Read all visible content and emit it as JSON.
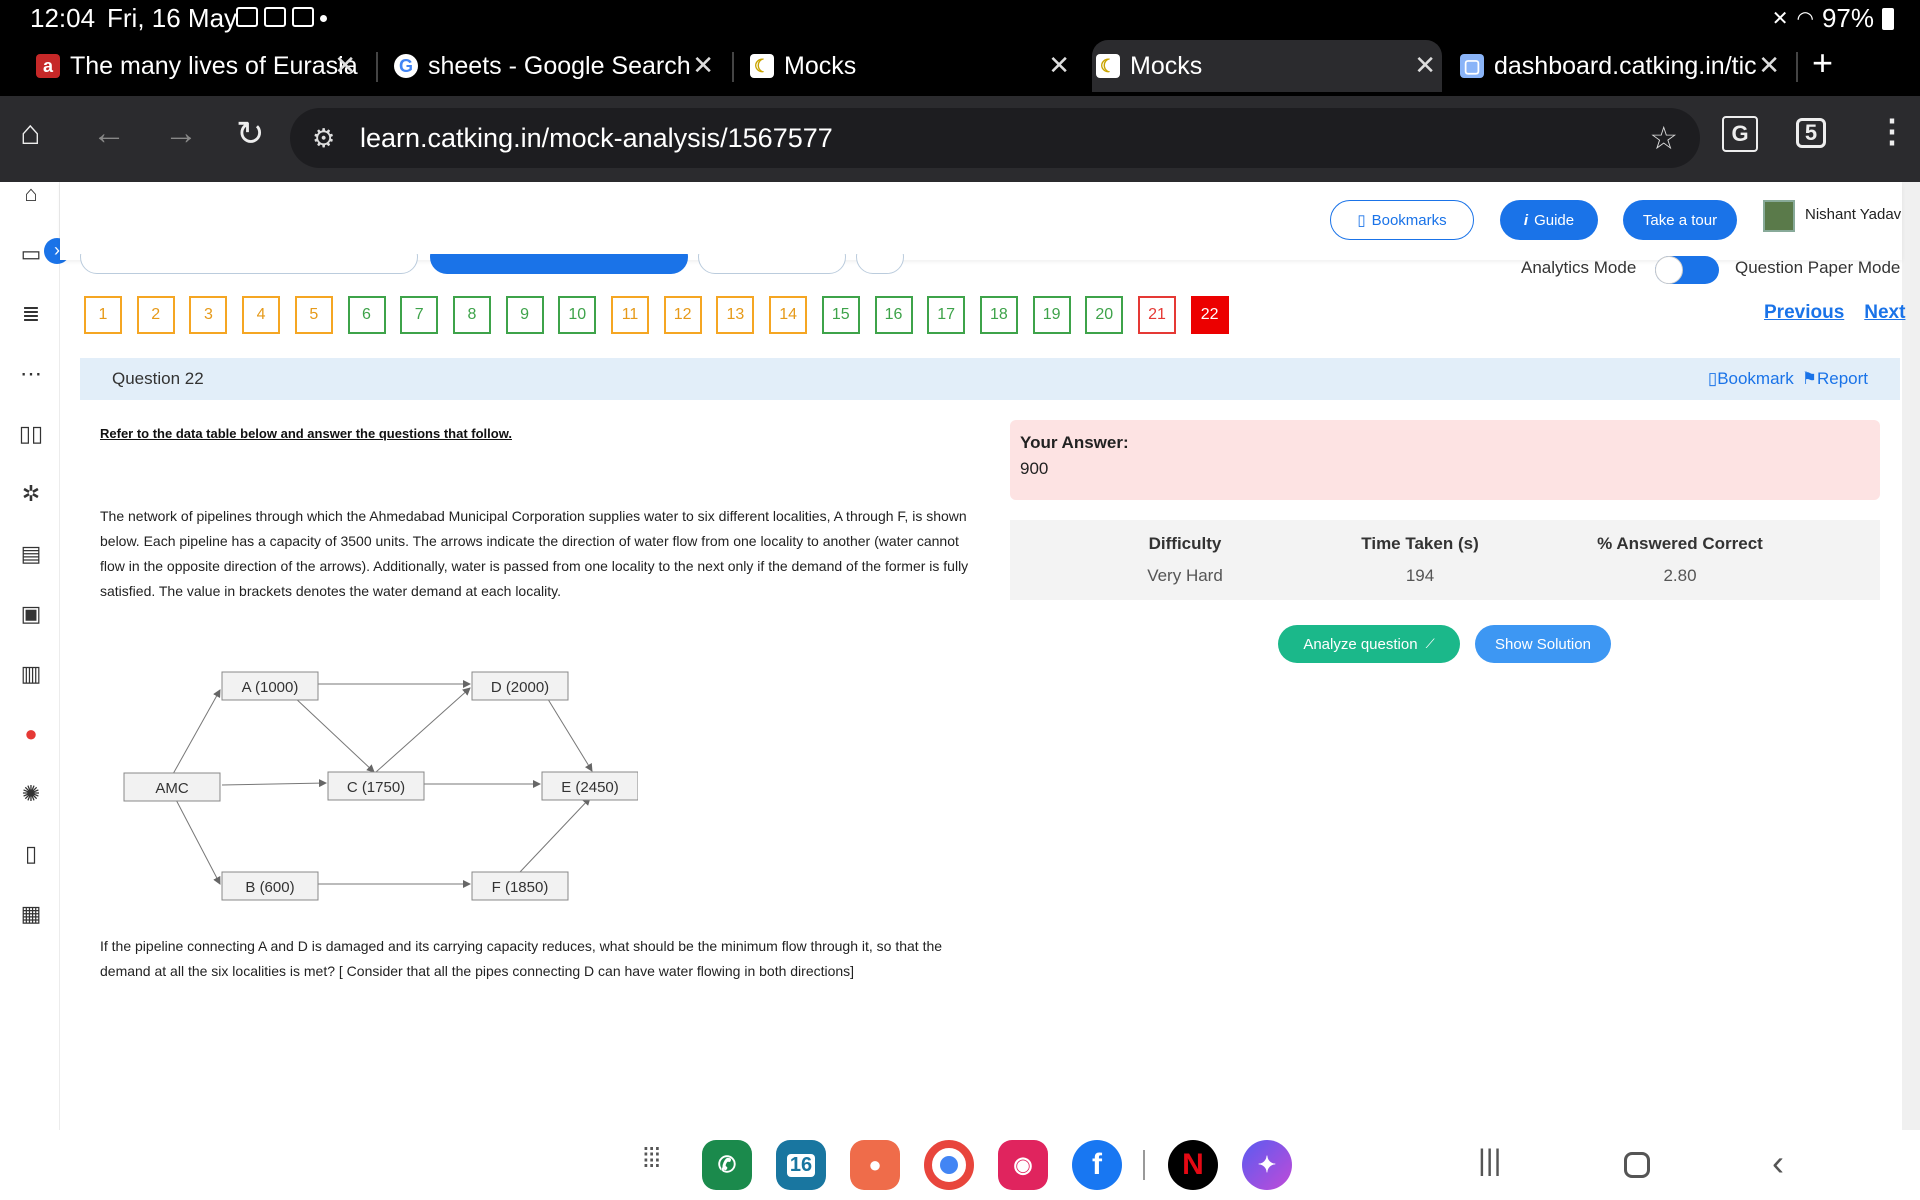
{
  "status_bar": {
    "time": "12:04",
    "date": "Fri, 16 May",
    "battery": "97%"
  },
  "tabs": [
    {
      "title": "The many lives of Eurasia",
      "favicon": "a"
    },
    {
      "title": "sheets - Google Search",
      "favicon": "G"
    },
    {
      "title": "Mocks",
      "favicon": "☾"
    },
    {
      "title": "Mocks",
      "favicon": "☾",
      "active": true
    },
    {
      "title": "dashboard.catking.in/tick",
      "favicon": "▢"
    }
  ],
  "new_tab": "+",
  "address": {
    "url": "learn.catking.in/mock-analysis/1567577",
    "tab_count": "5"
  },
  "topnav": {
    "bookmarks": "Bookmarks",
    "guide": "Guide",
    "tour": "Take a tour",
    "user": "Nishant Yadav"
  },
  "mode": {
    "left": "Analytics Mode",
    "right": "Question Paper Mode"
  },
  "question_numbers": [
    {
      "n": "1",
      "state": "orange"
    },
    {
      "n": "2",
      "state": "orange"
    },
    {
      "n": "3",
      "state": "orange"
    },
    {
      "n": "4",
      "state": "orange"
    },
    {
      "n": "5",
      "state": "orange"
    },
    {
      "n": "6",
      "state": "green"
    },
    {
      "n": "7",
      "state": "green"
    },
    {
      "n": "8",
      "state": "green"
    },
    {
      "n": "9",
      "state": "green"
    },
    {
      "n": "10",
      "state": "green"
    },
    {
      "n": "11",
      "state": "orange"
    },
    {
      "n": "12",
      "state": "orange"
    },
    {
      "n": "13",
      "state": "orange"
    },
    {
      "n": "14",
      "state": "orange"
    },
    {
      "n": "15",
      "state": "green"
    },
    {
      "n": "16",
      "state": "green"
    },
    {
      "n": "17",
      "state": "green"
    },
    {
      "n": "18",
      "state": "green"
    },
    {
      "n": "19",
      "state": "green"
    },
    {
      "n": "20",
      "state": "green"
    },
    {
      "n": "21",
      "state": "red"
    },
    {
      "n": "22",
      "state": "current"
    }
  ],
  "pager": {
    "previous": "Previous",
    "next": "Next"
  },
  "question_header": {
    "title": "Question 22",
    "bookmark": "Bookmark",
    "report": "Report"
  },
  "content": {
    "refer": "Refer to the data table below and answer the questions that follow.",
    "passage": "The network of pipelines through which the Ahmedabad Municipal Corporation supplies water to six different localities, A through F, is shown below. Each pipeline has a capacity of 3500 units. The arrows indicate the direction of water flow from one locality to another (water cannot flow in the opposite direction of the arrows). Additionally, water is passed from one locality to the next only if the demand of the former is fully satisfied. The value in brackets denotes the water demand at each locality.",
    "question": "If the pipeline connecting A and D is damaged and its carrying capacity reduces, what should be the minimum flow through it, so that the demand at all the six localities is met? [ Consider that all the pipes connecting D can have water flowing in both directions]"
  },
  "diagram_nodes": {
    "amc": "AMC",
    "a": "A (1000)",
    "b": "B (600)",
    "c": "C (1750)",
    "d": "D (2000)",
    "e": "E (2450)",
    "f": "F (1850)"
  },
  "answer": {
    "label": "Your Answer:",
    "value": "900"
  },
  "stats": {
    "difficulty_label": "Difficulty",
    "difficulty_value": "Very Hard",
    "time_label": "Time Taken (s)",
    "time_value": "194",
    "correct_label": "% Answered Correct",
    "correct_value": "2.80"
  },
  "actions": {
    "analyze": "Analyze question",
    "solution": "Show Solution"
  },
  "dock_calendar": "16",
  "colors": {
    "accent": "#1a73e8",
    "green": "#3ea34a",
    "orange": "#f5a623",
    "red": "#e53935",
    "answer_bg": "#fde3e3"
  }
}
